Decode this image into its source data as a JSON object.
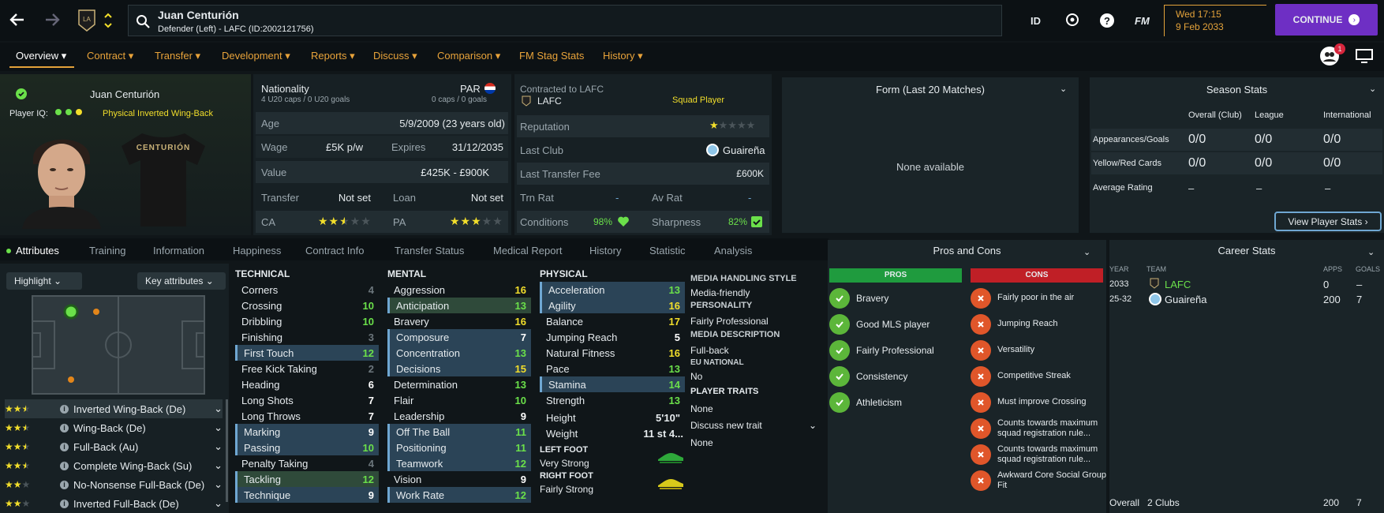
{
  "header": {
    "name": "Juan Centurión",
    "subtitle": "Defender (Left) - LAFC (ID:2002121756)",
    "time": "Wed 17:15",
    "date": "9 Feb 2033",
    "continue": "CONTINUE",
    "id_label": "ID",
    "fm_label": "FM",
    "notif_count": "1"
  },
  "nav": [
    "Overview",
    "Contract",
    "Transfer",
    "Development",
    "Reports",
    "Discuss",
    "Comparison",
    "FM Stag Stats",
    "History"
  ],
  "profile": {
    "name": "Juan Centurión",
    "iq_label": "Player IQ:",
    "role": "Physical Inverted Wing-Back",
    "shirt": "CENTURIÓN"
  },
  "info": {
    "nationality_label": "Nationality",
    "nation": "PAR",
    "caps": "4 U20 caps / 0 U20 goals",
    "caps2": "0 caps / 0 goals",
    "age_label": "Age",
    "age": "5/9/2009 (23 years old)",
    "wage_label": "Wage",
    "wage": "£5K p/w",
    "expires_label": "Expires",
    "expires": "31/12/2035",
    "value_label": "Value",
    "value": "£425K - £900K",
    "transfer_label": "Transfer",
    "transfer": "Not set",
    "loan_label": "Loan",
    "loan": "Not set",
    "ca_label": "CA",
    "pa_label": "PA",
    "ca_stars": 2.5,
    "pa_stars": 3
  },
  "contract": {
    "contracted": "Contracted to LAFC",
    "club": "LAFC",
    "squad": "Squad Player",
    "reputation_label": "Reputation",
    "last_club_label": "Last Club",
    "last_club": "Guaireña",
    "fee_label": "Last Transfer Fee",
    "fee": "£600K",
    "trn_label": "Trn Rat",
    "trn": "-",
    "av_label": "Av Rat",
    "av": "-",
    "cond_label": "Conditions",
    "cond": "98%",
    "sharp_label": "Sharpness",
    "sharp": "82%"
  },
  "form": {
    "title": "Form (Last 20 Matches)",
    "empty": "None available"
  },
  "season": {
    "title": "Season Stats",
    "cols": [
      "Overall (Club)",
      "League",
      "International"
    ],
    "rows": [
      {
        "label": "Appearances/Goals",
        "vals": [
          "0/0",
          "0/0",
          "0/0"
        ]
      },
      {
        "label": "Yellow/Red Cards",
        "vals": [
          "0/0",
          "0/0",
          "0/0"
        ]
      },
      {
        "label": "Average Rating",
        "vals": [
          "–",
          "–",
          "–"
        ]
      }
    ],
    "button": "View Player Stats"
  },
  "tabs": [
    "Attributes",
    "Training",
    "Information",
    "Happiness",
    "Contract Info",
    "Transfer Status",
    "Medical Report",
    "History",
    "Statistic",
    "Analysis"
  ],
  "controls": {
    "highlight": "Highlight",
    "key": "Key attributes"
  },
  "roles": [
    {
      "name": "Inverted Wing-Back (De)",
      "stars": 2.5
    },
    {
      "name": "Wing-Back (De)",
      "stars": 2.5
    },
    {
      "name": "Full-Back (Au)",
      "stars": 2.5
    },
    {
      "name": "Complete Wing-Back (Su)",
      "stars": 2.5
    },
    {
      "name": "No-Nonsense Full-Back (De)",
      "stars": 2
    },
    {
      "name": "Inverted Full-Back (De)",
      "stars": 2
    }
  ],
  "technical": {
    "title": "TECHNICAL",
    "items": [
      [
        "Corners",
        "4"
      ],
      [
        "Crossing",
        "10"
      ],
      [
        "Dribbling",
        "10"
      ],
      [
        "Finishing",
        "3"
      ],
      [
        "First Touch",
        "12"
      ],
      [
        "Free Kick Taking",
        "2"
      ],
      [
        "Heading",
        "6"
      ],
      [
        "Long Shots",
        "7"
      ],
      [
        "Long Throws",
        "7"
      ],
      [
        "Marking",
        "9"
      ],
      [
        "Passing",
        "10"
      ],
      [
        "Penalty Taking",
        "4"
      ],
      [
        "Tackling",
        "12"
      ],
      [
        "Technique",
        "9"
      ]
    ]
  },
  "mental": {
    "title": "MENTAL",
    "items": [
      [
        "Aggression",
        "16"
      ],
      [
        "Anticipation",
        "13"
      ],
      [
        "Bravery",
        "16"
      ],
      [
        "Composure",
        "7"
      ],
      [
        "Concentration",
        "13"
      ],
      [
        "Decisions",
        "15"
      ],
      [
        "Determination",
        "13"
      ],
      [
        "Flair",
        "10"
      ],
      [
        "Leadership",
        "9"
      ],
      [
        "Off The Ball",
        "11"
      ],
      [
        "Positioning",
        "11"
      ],
      [
        "Teamwork",
        "12"
      ],
      [
        "Vision",
        "9"
      ],
      [
        "Work Rate",
        "12"
      ]
    ]
  },
  "physical": {
    "title": "PHYSICAL",
    "items": [
      [
        "Acceleration",
        "13"
      ],
      [
        "Agility",
        "16"
      ],
      [
        "Balance",
        "17"
      ],
      [
        "Jumping Reach",
        "5"
      ],
      [
        "Natural Fitness",
        "16"
      ],
      [
        "Pace",
        "13"
      ],
      [
        "Stamina",
        "14"
      ],
      [
        "Strength",
        "13"
      ]
    ],
    "height_label": "Height",
    "height": "5'10\"",
    "weight_label": "Weight",
    "weight": "11 st 4...",
    "left_label": "LEFT FOOT",
    "left": "Very Strong",
    "right_label": "RIGHT FOOT",
    "right": "Fairly Strong"
  },
  "media": {
    "mh_title": "MEDIA HANDLING STYLE",
    "mh": "Media-friendly",
    "pers_title": "PERSONALITY",
    "pers": "Fairly Professional",
    "md_title": "MEDIA DESCRIPTION",
    "md": "Full-back",
    "eu_title": "EU NATIONAL",
    "eu": "No",
    "traits_title": "PLAYER TRAITS",
    "traits": "None",
    "discuss": "Discuss new trait",
    "discuss_val": "None"
  },
  "pros": {
    "title": "Pros and Cons",
    "pros_label": "PROS",
    "cons_label": "CONS",
    "pros": [
      "Bravery",
      "Good MLS player",
      "Fairly Professional",
      "Consistency",
      "Athleticism"
    ],
    "cons": [
      "Fairly poor in the air",
      "Jumping Reach",
      "Versatility",
      "Competitive Streak",
      "Must improve Crossing",
      "Counts towards maximum squad registration rule...",
      "Counts towards maximum squad registration rule...",
      "Awkward Core Social Group Fit"
    ]
  },
  "career": {
    "title": "Career Stats",
    "cols": [
      "YEAR",
      "TEAM",
      "APPS",
      "GOALS"
    ],
    "rows": [
      {
        "year": "2033",
        "team": "LAFC",
        "apps": "0",
        "goals": "–"
      },
      {
        "year": "25-32",
        "team": "Guaireña",
        "apps": "200",
        "goals": "7"
      }
    ],
    "overall": "Overall",
    "clubs": "2 Clubs",
    "total_apps": "200",
    "total_goals": "7"
  },
  "colors": {
    "accent": "#6e2fc4",
    "orange": "#e3a23a",
    "yellow": "#f2de2b",
    "green": "#6be04a",
    "pros": "#1f9b3e",
    "cons": "#c01f26"
  }
}
